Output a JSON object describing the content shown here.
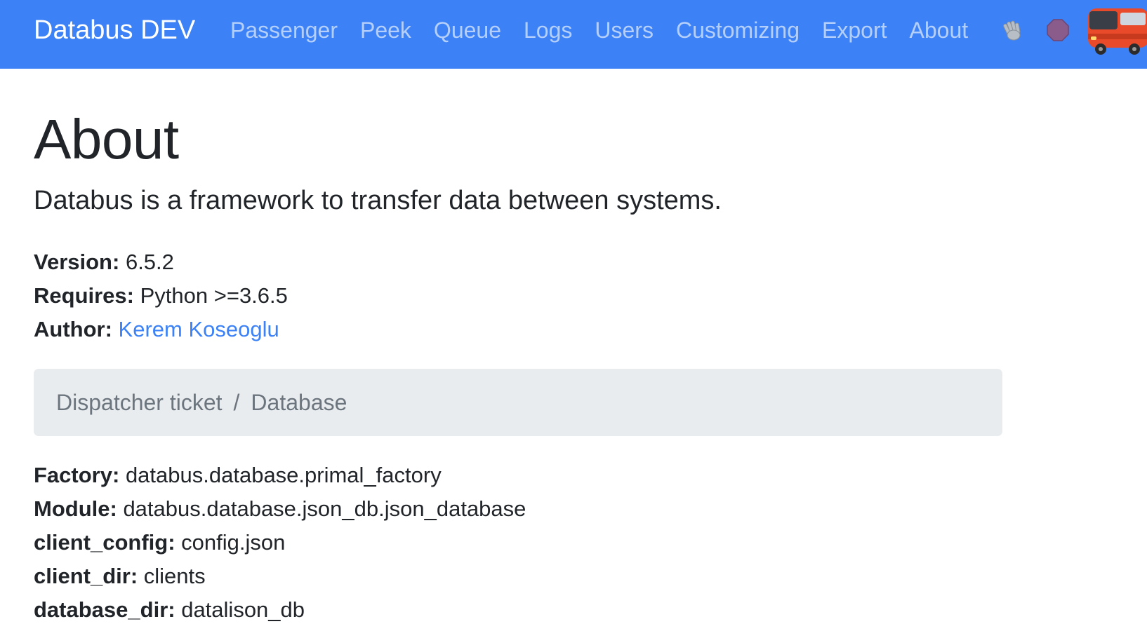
{
  "navbar": {
    "brand": "Databus DEV",
    "links": [
      "Passenger",
      "Peek",
      "Queue",
      "Logs",
      "Users",
      "Customizing",
      "Export",
      "About"
    ],
    "icons": [
      "waving-hand-icon",
      "stop-sign-icon"
    ],
    "logo": "bus-logo",
    "background": "#3c82f6"
  },
  "page": {
    "title": "About",
    "lead": "Databus is a framework to transfer data between systems."
  },
  "info": {
    "version_label": "Version:",
    "version_value": "6.5.2",
    "requires_label": "Requires:",
    "requires_value": "Python >=3.6.5",
    "author_label": "Author:",
    "author_value": "Kerem Koseoglu",
    "link_color": "#3c82f6"
  },
  "breadcrumb": {
    "items": [
      "Dispatcher ticket",
      "Database"
    ],
    "separator": "/"
  },
  "details": [
    {
      "label": "Factory:",
      "value": "databus.database.primal_factory"
    },
    {
      "label": "Module:",
      "value": "databus.database.json_db.json_database"
    },
    {
      "label": "client_config:",
      "value": "config.json"
    },
    {
      "label": "client_dir:",
      "value": "clients"
    },
    {
      "label": "database_dir:",
      "value": "datalison_db"
    }
  ]
}
